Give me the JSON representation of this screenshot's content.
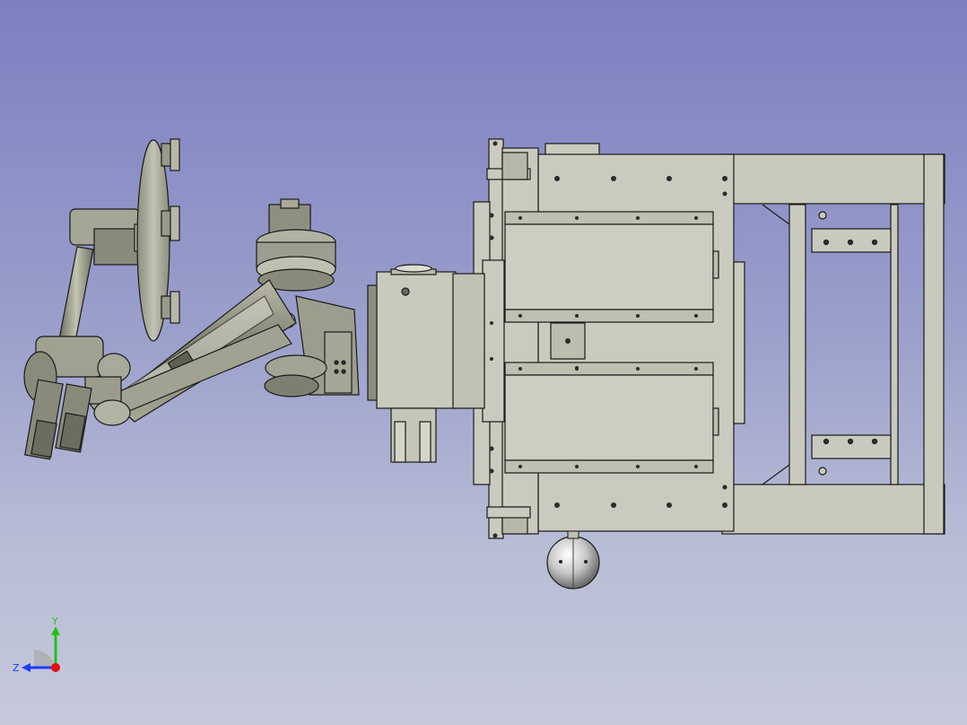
{
  "viewport": {
    "background_top": "#7d7fc0",
    "background_bottom": "#c6c9da"
  },
  "model": {
    "part_color": "#c9c9bd",
    "dark_part_color": "#8e8e7e",
    "edge_color": "#1a1a1a",
    "chrome_color": "#d8d8d8"
  },
  "axis_triad": {
    "y_label": "Y",
    "z_label": "Z",
    "y_color": "#1fc21f",
    "z_color": "#1c3cff",
    "x_color": "#e01010"
  }
}
